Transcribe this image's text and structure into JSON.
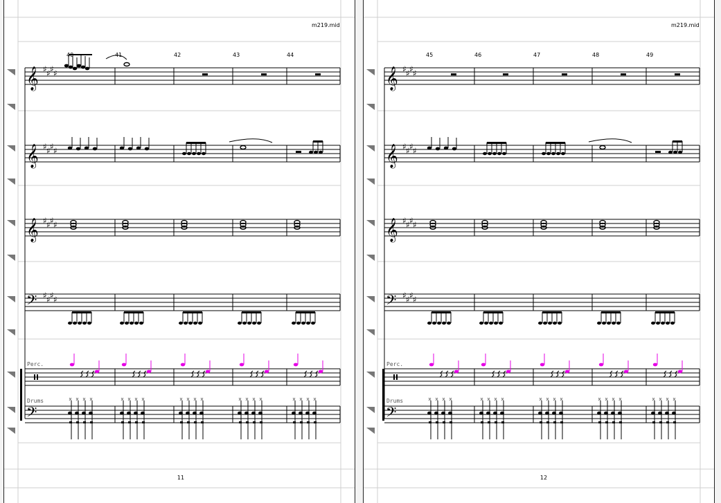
{
  "document": {
    "pages": [
      {
        "filename": "m219.mid",
        "page_number": "11",
        "measures": [
          "40",
          "41",
          "42",
          "43",
          "44"
        ],
        "perc_label": "Perc.",
        "drums_label": "Drums"
      },
      {
        "filename": "m219.mid",
        "page_number": "12",
        "measures": [
          "45",
          "46",
          "47",
          "48",
          "49"
        ],
        "perc_label": "Perc.",
        "drums_label": "Drums"
      }
    ],
    "staff_count": 6,
    "colors": {
      "staff": "#000000",
      "guide": "#cfcfcf",
      "handle": "#777777",
      "perc_notes": "#e600e6",
      "key_signature_faded": "#cccccc"
    },
    "icons": [
      "staff-collapse-handle-icon",
      "treble-clef-icon",
      "bass-clef-icon",
      "percussion-clef-icon"
    ]
  }
}
